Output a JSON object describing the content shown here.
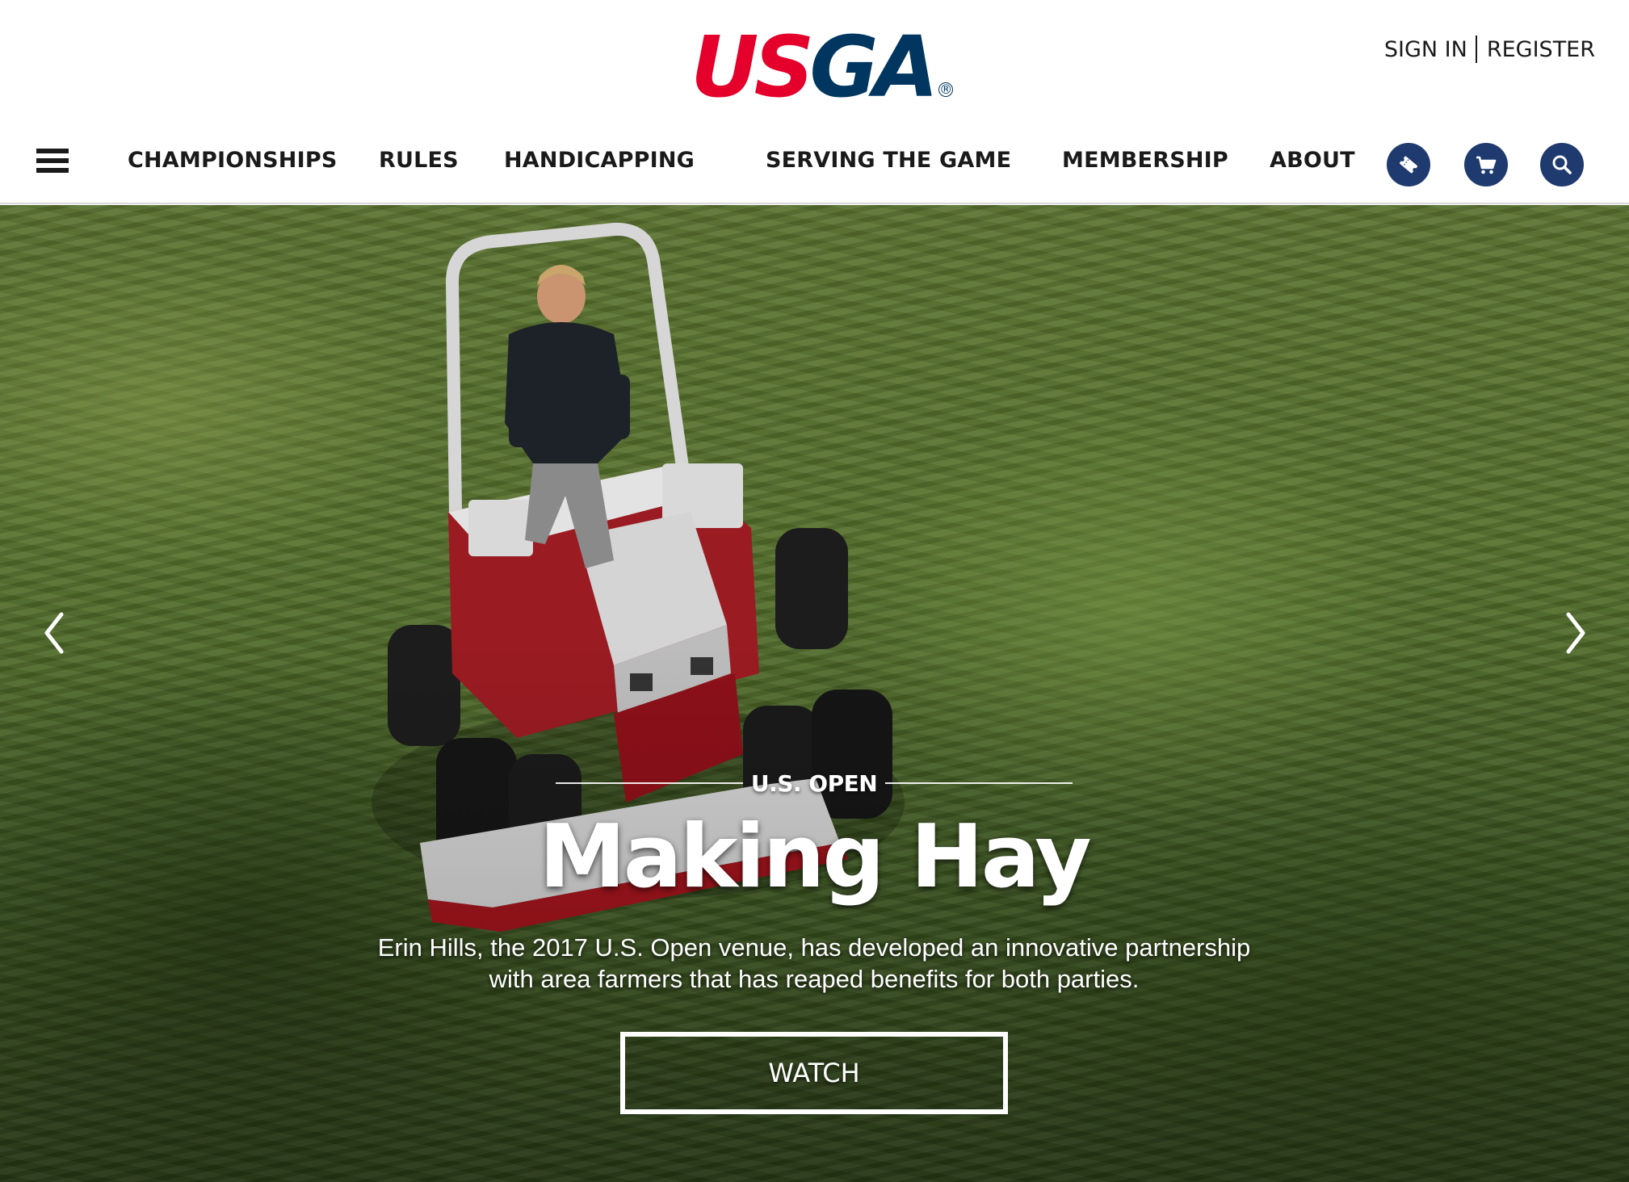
{
  "brand": {
    "logo_part1": "US",
    "logo_part2": "GA",
    "registered_mark": "®",
    "colors": {
      "red": "#e4002b",
      "navy": "#00365f",
      "button_navy": "#1f3a6e"
    }
  },
  "auth": {
    "sign_in": "SIGN IN",
    "register": "REGISTER"
  },
  "nav": {
    "menu_icon": "hamburger-icon",
    "items": [
      {
        "label": "CHAMPIONSHIPS"
      },
      {
        "label": "RULES"
      },
      {
        "label": "HANDICAPPING"
      },
      {
        "label": "SERVING THE GAME"
      },
      {
        "label": "MEMBERSHIP"
      },
      {
        "label": "ABOUT"
      }
    ],
    "icon_buttons": [
      {
        "icon": "ticket-icon"
      },
      {
        "icon": "cart-icon"
      },
      {
        "icon": "search-icon"
      }
    ]
  },
  "hero": {
    "eyebrow": "U.S. OPEN",
    "headline": "Making Hay",
    "description_line1": "Erin Hills, the 2017 U.S. Open venue, has developed an innovative partnership",
    "description_line2": "with area farmers that has reaped benefits for both parties.",
    "cta": "WATCH",
    "prev_icon": "chevron-left-icon",
    "next_icon": "chevron-right-icon"
  }
}
